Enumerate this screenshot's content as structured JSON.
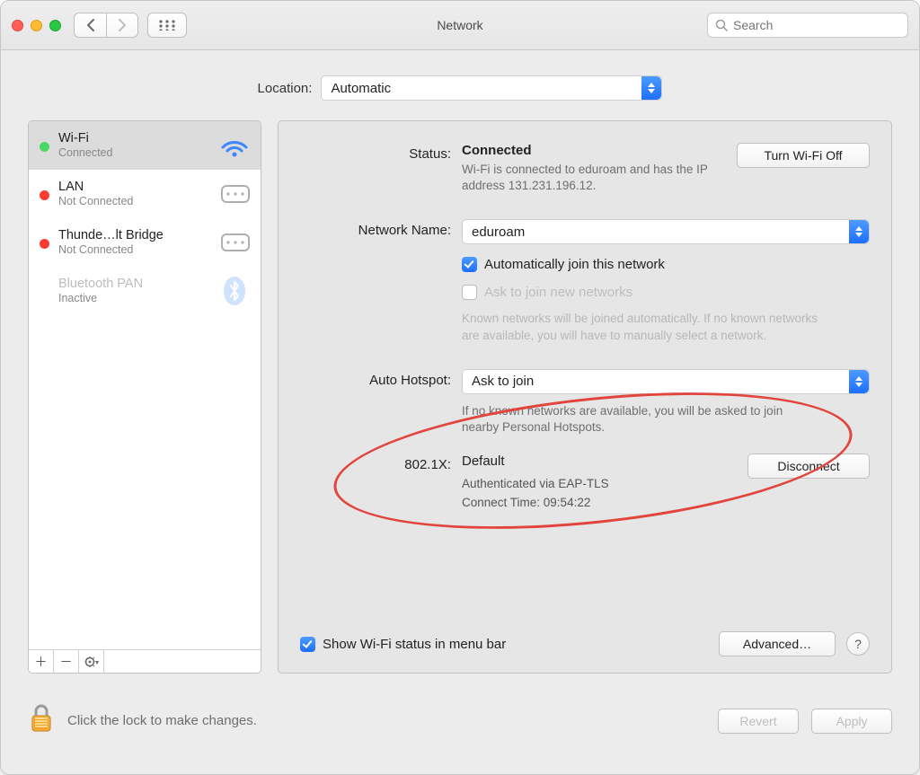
{
  "window": {
    "title": "Network"
  },
  "search": {
    "placeholder": "Search"
  },
  "location": {
    "label": "Location:",
    "value": "Automatic"
  },
  "sidebar": {
    "items": [
      {
        "name": "Wi-Fi",
        "status": "Connected",
        "dot": "green",
        "icon": "wifi",
        "dim": false
      },
      {
        "name": "LAN",
        "status": "Not Connected",
        "dot": "red",
        "icon": "ethernet",
        "dim": false
      },
      {
        "name": "Thunde…lt Bridge",
        "status": "Not Connected",
        "dot": "red",
        "icon": "ethernet",
        "dim": false
      },
      {
        "name": "Bluetooth PAN",
        "status": "Inactive",
        "dot": "none",
        "icon": "bluetooth",
        "dim": true
      }
    ]
  },
  "panel": {
    "status_label": "Status:",
    "status_value": "Connected",
    "turn_off": "Turn Wi-Fi Off",
    "status_desc": "Wi-Fi is connected to eduroam and has the IP address 131.231.196.12.",
    "network_name_label": "Network Name:",
    "network_name_value": "eduroam",
    "auto_join": "Automatically join this network",
    "ask_join": "Ask to join new networks",
    "ask_join_desc": "Known networks will be joined automatically. If no known networks are available, you will have to manually select a network.",
    "auto_hotspot_label": "Auto Hotspot:",
    "auto_hotspot_value": "Ask to join",
    "auto_hotspot_desc": "If no known networks are available, you will be asked to join nearby Personal Hotspots.",
    "dot1x_label": "802.1X:",
    "dot1x_value": "Default",
    "disconnect": "Disconnect",
    "dot1x_line1": "Authenticated via EAP-TLS",
    "dot1x_line2": "Connect Time: 09:54:22",
    "show_menu": "Show Wi-Fi status in menu bar",
    "advanced": "Advanced…",
    "help": "?"
  },
  "footer": {
    "lock": "Click the lock to make changes.",
    "revert": "Revert",
    "apply": "Apply"
  }
}
